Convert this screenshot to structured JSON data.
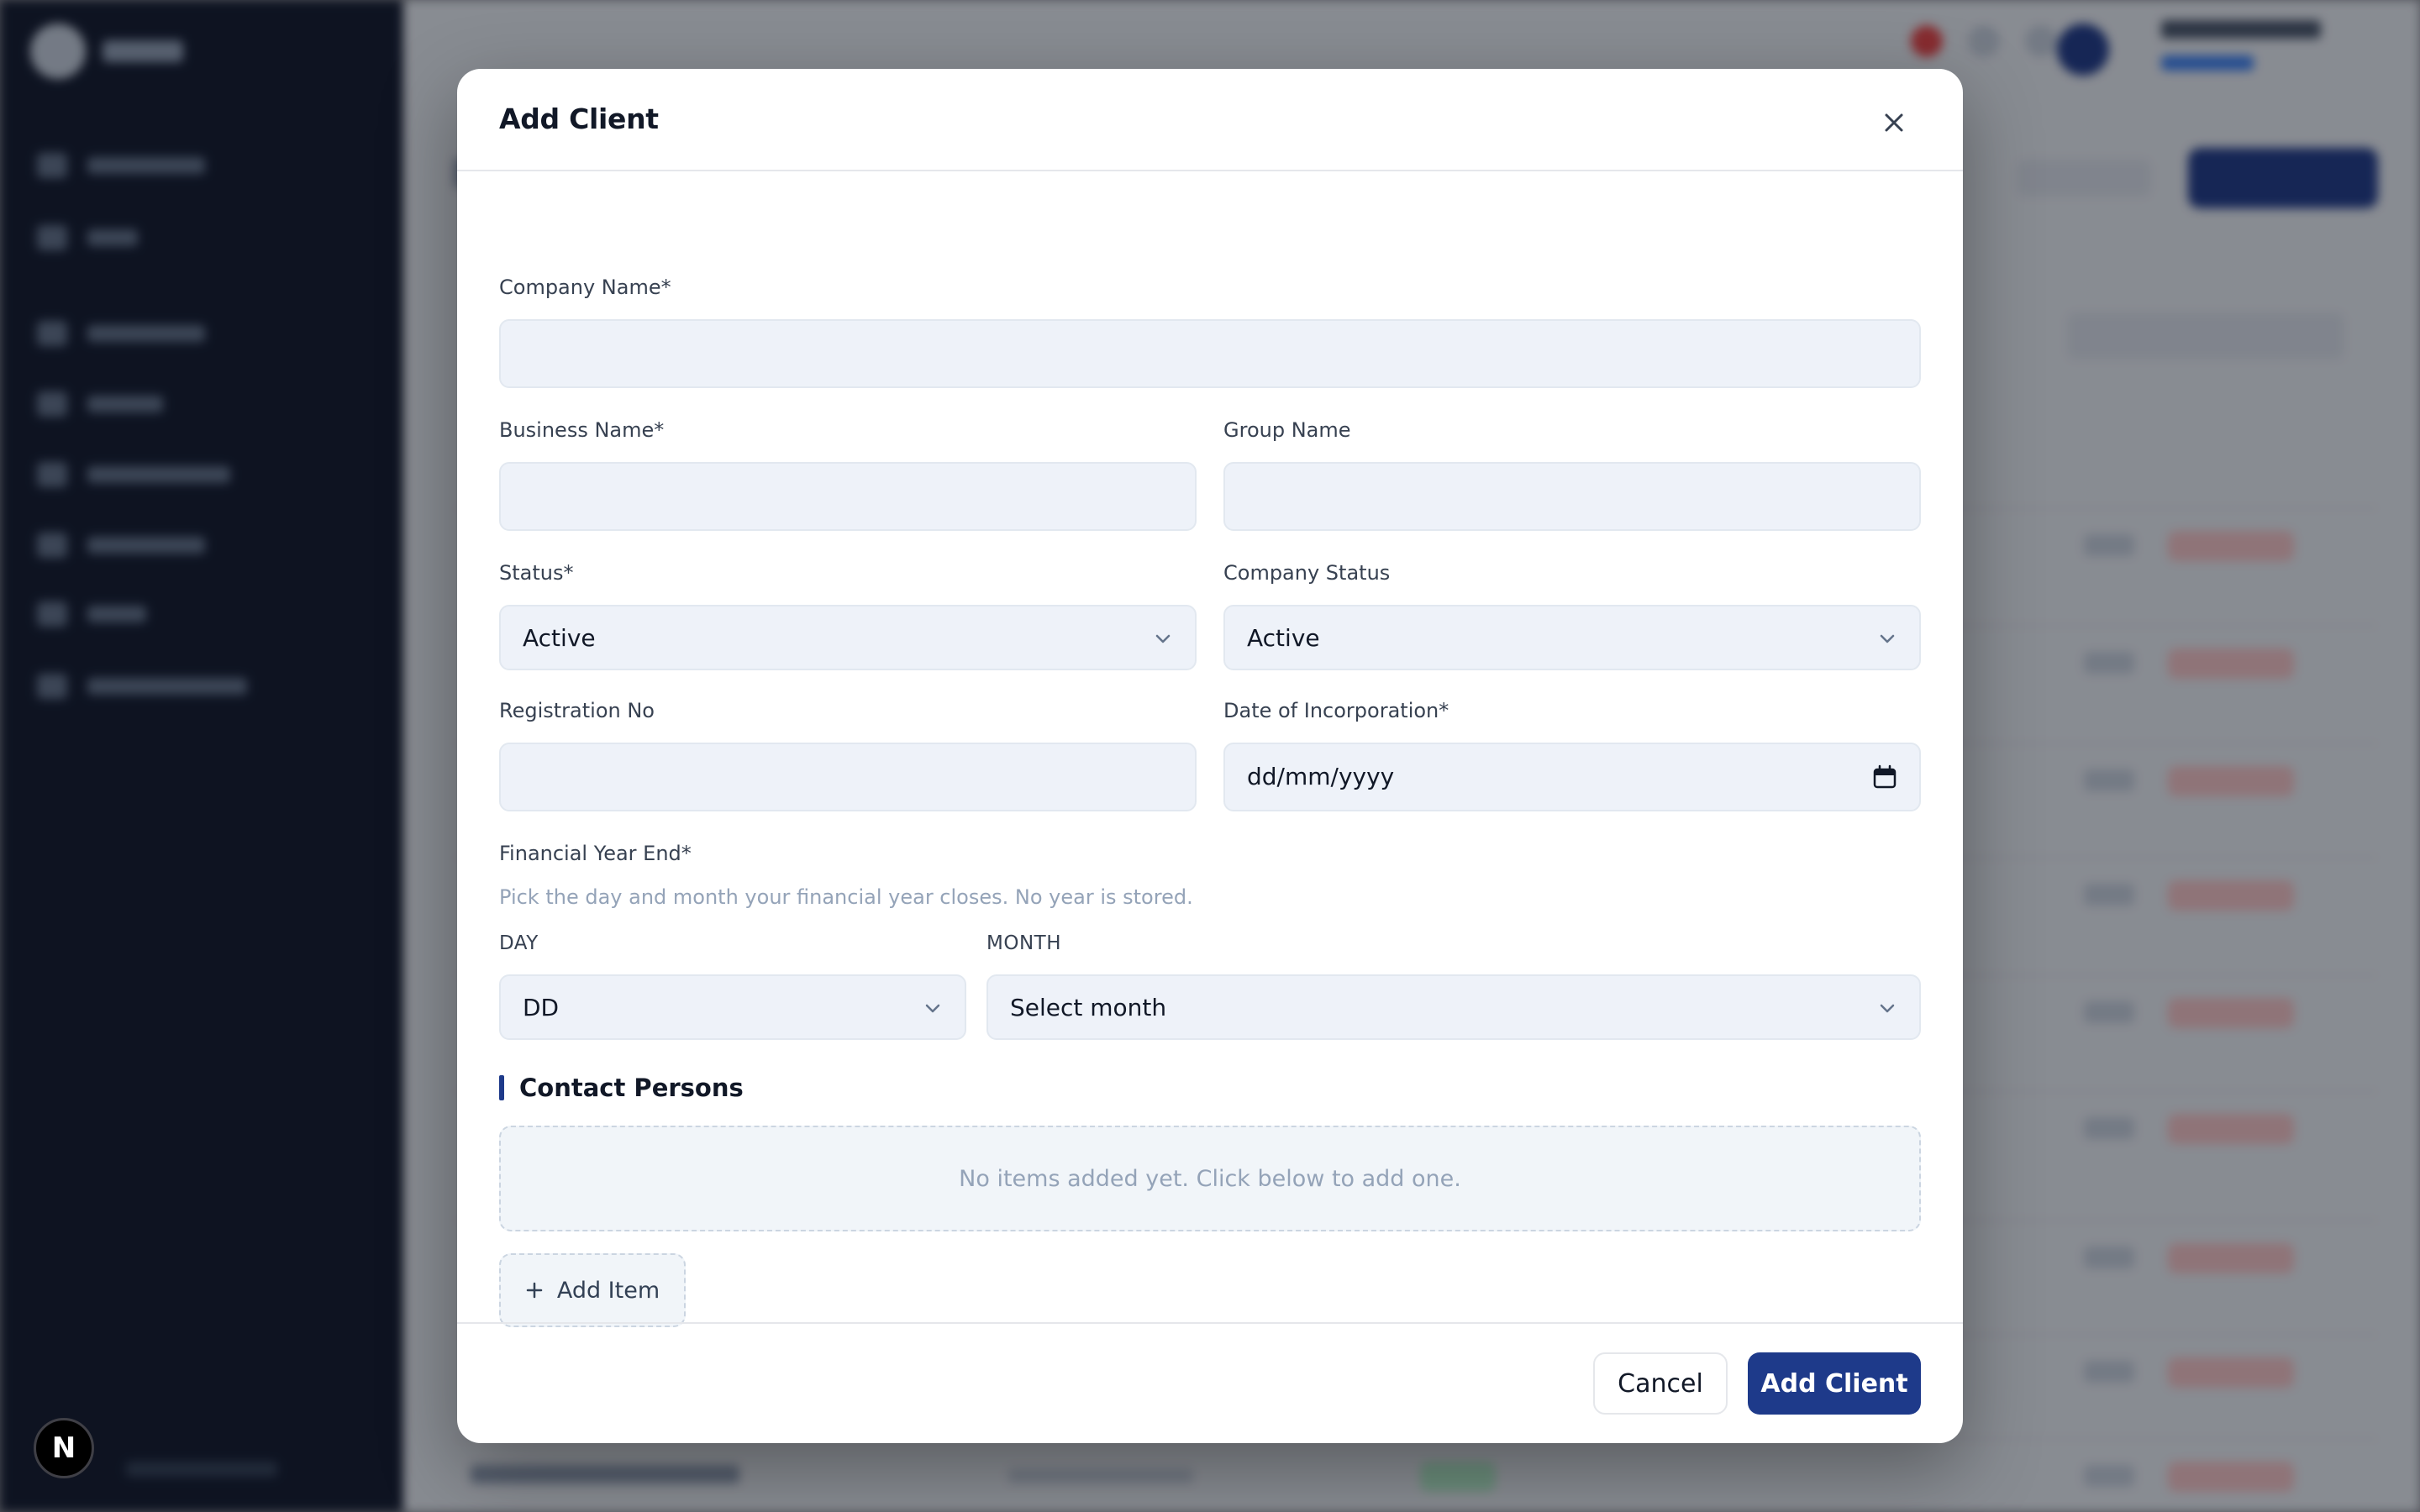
{
  "modal": {
    "title": "Add Client",
    "fields": {
      "company_name": {
        "label": "Company Name*",
        "value": ""
      },
      "business_name": {
        "label": "Business Name*",
        "value": ""
      },
      "group_name": {
        "label": "Group Name",
        "value": ""
      },
      "status": {
        "label": "Status*",
        "value": "Active"
      },
      "company_status": {
        "label": "Company Status",
        "value": "Active"
      },
      "registration_no": {
        "label": "Registration No",
        "value": ""
      },
      "date_of_incorporation": {
        "label": "Date of Incorporation*",
        "placeholder": "dd/mm/yyyy"
      }
    },
    "financial_year_end": {
      "label": "Financial Year End*",
      "hint": "Pick the day and month your financial year closes. No year is stored.",
      "day_label": "DAY",
      "day_value": "DD",
      "month_label": "MONTH",
      "month_value": "Select month"
    },
    "contact_persons": {
      "title": "Contact Persons",
      "empty_text": "No items added yet. Click below to add one.",
      "add_label": "Add Item"
    },
    "footer": {
      "cancel_label": "Cancel",
      "submit_label": "Add Client"
    }
  },
  "badge": {
    "letter": "N"
  },
  "colors": {
    "primary": "#1e3a8a",
    "sidebar": "#0f172a",
    "field_bg": "#eef2f9",
    "muted_text": "#94a3b8"
  },
  "icons": {
    "close": "close-icon",
    "chevron": "chevron-down-icon",
    "calendar": "calendar-icon",
    "plus": "plus-icon"
  }
}
